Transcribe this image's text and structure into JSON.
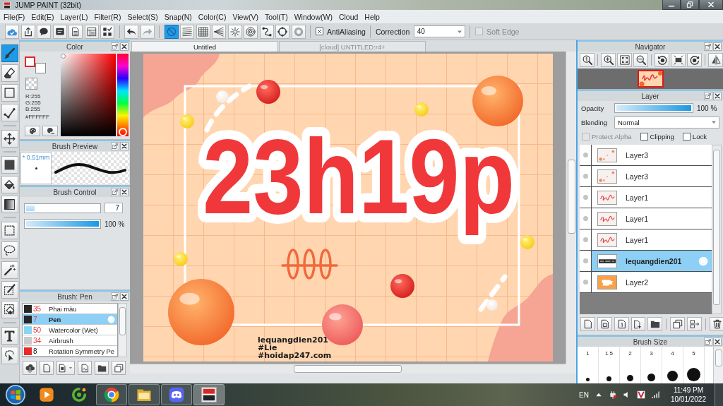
{
  "window": {
    "title": "JUMP PAINT (32bit)"
  },
  "menu": [
    "File(F)",
    "Edit(E)",
    "Layer(L)",
    "Filter(R)",
    "Select(S)",
    "Snap(N)",
    "Color(C)",
    "View(V)",
    "Tool(T)",
    "Window(W)",
    "Cloud",
    "Help"
  ],
  "file_buttons": [
    {
      "kind": "cloud",
      "disabled": false
    },
    {
      "kind": "share",
      "disabled": false
    },
    {
      "kind": "bubble",
      "disabled": false
    },
    {
      "kind": "comment",
      "disabled": false
    },
    {
      "kind": "page",
      "disabled": false
    },
    {
      "kind": "list",
      "disabled": false
    },
    {
      "kind": "gridcheck",
      "disabled": false
    }
  ],
  "history_buttons": [
    {
      "kind": "undo",
      "disabled": false
    },
    {
      "kind": "redo",
      "disabled": true
    }
  ],
  "snaps": [
    {
      "kind": "nosnap",
      "selected": true,
      "disabled": false
    },
    {
      "kind": "parallel",
      "selected": false,
      "disabled": false
    },
    {
      "kind": "grid",
      "selected": false,
      "disabled": false
    },
    {
      "kind": "perspective",
      "selected": false,
      "disabled": false
    },
    {
      "kind": "radial",
      "selected": false,
      "disabled": false
    },
    {
      "kind": "concentric",
      "selected": false,
      "disabled": false
    },
    {
      "kind": "curve",
      "selected": false,
      "disabled": false
    },
    {
      "kind": "ellipse",
      "selected": false,
      "disabled": false
    },
    {
      "kind": "settings",
      "selected": false,
      "disabled": true
    }
  ],
  "options": {
    "antialiasing": {
      "label": "AntiAliasing",
      "checked": true
    },
    "correction": {
      "label": "Correction",
      "value": "40"
    },
    "soft_edge": {
      "label": "Soft Edge",
      "checked": false,
      "disabled": true
    }
  },
  "tools": [
    [
      {
        "kind": "brush",
        "selected": true
      },
      {
        "kind": "eraser",
        "selected": false
      },
      {
        "kind": "rect",
        "selected": false
      },
      {
        "kind": "vector",
        "selected": false
      }
    ],
    [
      {
        "kind": "move",
        "selected": false
      }
    ],
    [
      {
        "kind": "fill",
        "selected": false
      },
      {
        "kind": "bucket",
        "selected": false
      },
      {
        "kind": "gradient",
        "selected": false
      }
    ],
    [
      {
        "kind": "select",
        "selected": false
      },
      {
        "kind": "lasso",
        "selected": false
      },
      {
        "kind": "wand",
        "selected": false
      },
      {
        "kind": "selpen",
        "selected": false
      },
      {
        "kind": "selerase",
        "selected": false
      }
    ],
    [
      {
        "kind": "text",
        "selected": false
      },
      {
        "kind": "operation",
        "selected": false
      }
    ]
  ],
  "color_panel": {
    "title": "Color",
    "swatches": [
      {
        "color": "#ffffff",
        "selected": true
      },
      {
        "color": "#ffffff",
        "selected": false
      }
    ],
    "hue": {
      "level": 0
    },
    "r": "R:255",
    "g": "G:255",
    "b": "B:255",
    "hex": "#FFFFFF"
  },
  "brush_preview": {
    "title": "Brush Preview",
    "size": "* 0.51mm"
  },
  "brush_control": {
    "title": "Brush Control",
    "size": {
      "level": 0.12,
      "value": "7"
    },
    "opacity": {
      "level": 1,
      "reading": "100 %"
    }
  },
  "brush_list": {
    "title": "Brush: Pen",
    "items": [
      {
        "color": "#262626",
        "size": "35",
        "emphasized": true,
        "name": "Phai màu",
        "selected": false
      },
      {
        "color": "#262626",
        "size": "7",
        "emphasized": true,
        "name": "Pen",
        "selected": true
      },
      {
        "color": "#86d6f2",
        "size": "50",
        "emphasized": true,
        "name": "Watercolor (Wet)",
        "selected": false
      },
      {
        "color": "#c9c9c9",
        "size": "34",
        "emphasized": true,
        "name": "Airbrush",
        "selected": false
      },
      {
        "color": "#e82a2a",
        "size": "8",
        "emphasized": false,
        "name": "Rotation Symmetry Pe",
        "selected": false
      }
    ]
  },
  "tabs": [
    {
      "label": "Untitled",
      "selected": true
    },
    {
      "label": "[cloud] UNTITLED:r4+",
      "selected": false
    }
  ],
  "canvas": {
    "lettering": "23h19p",
    "caption": [
      "lequangdien201",
      "#Lie",
      "#hoidap247.com"
    ]
  },
  "navigator": {
    "title": "Navigator"
  },
  "layer_panel": {
    "title": "Layer",
    "opacity": {
      "label": "Opacity",
      "level": 1,
      "reading": "100 %"
    },
    "blending": {
      "label": "Blending",
      "value": "Normal"
    },
    "protect_alpha": {
      "label": "Protect Alpha",
      "checked": false,
      "disabled": true
    },
    "clipping": {
      "label": "Clipping",
      "checked": false,
      "disabled": false
    },
    "lock": {
      "label": "Lock",
      "checked": false,
      "disabled": false
    },
    "layers": [
      {
        "name": "Layer3",
        "kind": "dots",
        "selected": false
      },
      {
        "name": "Layer3",
        "kind": "dots",
        "selected": false
      },
      {
        "name": "Layer1",
        "kind": "lettering",
        "selected": false
      },
      {
        "name": "Layer1",
        "kind": "lettering",
        "selected": false
      },
      {
        "name": "Layer1",
        "kind": "lettering",
        "selected": false
      },
      {
        "name": "lequangdien201",
        "kind": "text",
        "selected": true
      },
      {
        "name": "Layer2",
        "kind": "fill",
        "selected": false
      }
    ]
  },
  "brush_size": {
    "title": "Brush Size",
    "sizes": [
      "1",
      "1.5",
      "2",
      "3",
      "4",
      "5"
    ]
  },
  "taskbar": {
    "apps": [
      {
        "kind": "media",
        "running": false,
        "selected": false
      },
      {
        "kind": "swirl",
        "running": false,
        "selected": false
      },
      {
        "kind": "browser",
        "running": true,
        "selected": false
      },
      {
        "kind": "explorer",
        "running": true,
        "selected": false
      },
      {
        "kind": "chat",
        "running": true,
        "selected": false
      },
      {
        "kind": "paintapp",
        "running": true,
        "selected": true
      }
    ],
    "language": "EN",
    "time": "11:49 PM",
    "date": "10/01/2022"
  }
}
